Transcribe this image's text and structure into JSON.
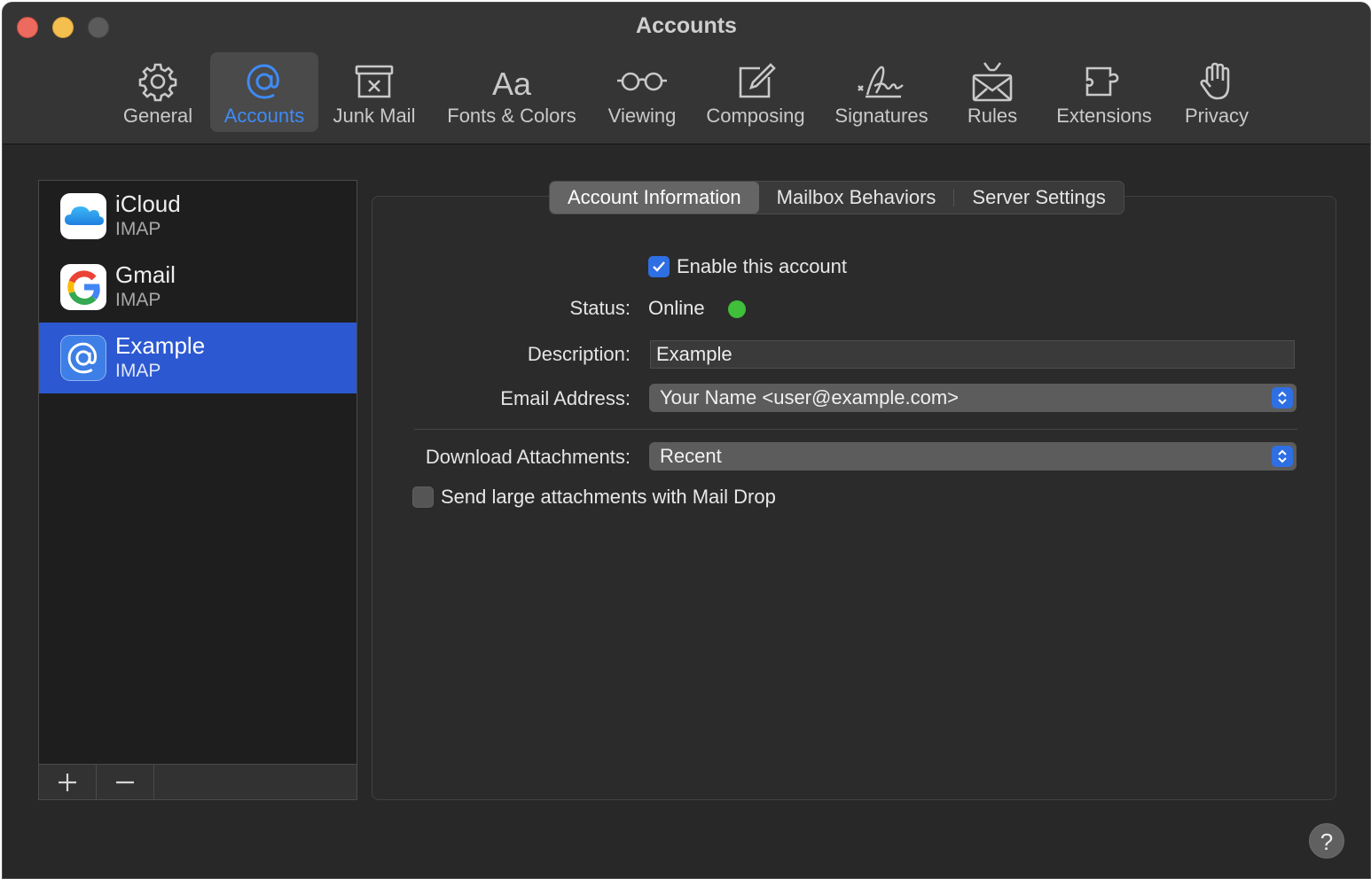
{
  "window": {
    "title": "Accounts"
  },
  "toolbar": {
    "items": [
      {
        "label": "General",
        "icon": "gear-icon"
      },
      {
        "label": "Accounts",
        "icon": "at-sign-icon",
        "active": true
      },
      {
        "label": "Junk Mail",
        "icon": "junk-bin-icon"
      },
      {
        "label": "Fonts & Colors",
        "icon": "font-aa-icon"
      },
      {
        "label": "Viewing",
        "icon": "glasses-icon"
      },
      {
        "label": "Composing",
        "icon": "compose-pencil-icon"
      },
      {
        "label": "Signatures",
        "icon": "signature-icon"
      },
      {
        "label": "Rules",
        "icon": "envelope-rules-icon"
      },
      {
        "label": "Extensions",
        "icon": "puzzle-icon"
      },
      {
        "label": "Privacy",
        "icon": "hand-icon"
      }
    ],
    "accent_color": "#3f8bf5"
  },
  "accounts": [
    {
      "name": "iCloud",
      "type": "IMAP",
      "icon": "icloud-icon"
    },
    {
      "name": "Gmail",
      "type": "IMAP",
      "icon": "google-icon"
    },
    {
      "name": "Example",
      "type": "IMAP",
      "icon": "at-sign-icon",
      "selected": true
    }
  ],
  "sidebar_buttons": {
    "add": "+",
    "remove": "—"
  },
  "tabs": [
    {
      "label": "Account Information",
      "active": true
    },
    {
      "label": "Mailbox Behaviors"
    },
    {
      "label": "Server Settings"
    }
  ],
  "form": {
    "enable_label": "Enable this account",
    "enable_checked": true,
    "status_label": "Status:",
    "status_value": "Online",
    "status_color": "#3fbf3a",
    "description_label": "Description:",
    "description_value": "Example",
    "email_label": "Email Address:",
    "email_value": "Your Name <user@example.com>",
    "download_label": "Download Attachments:",
    "download_value": "Recent",
    "maildrop_label": "Send large attachments with Mail Drop",
    "maildrop_checked": false
  },
  "help": {
    "label": "?"
  }
}
